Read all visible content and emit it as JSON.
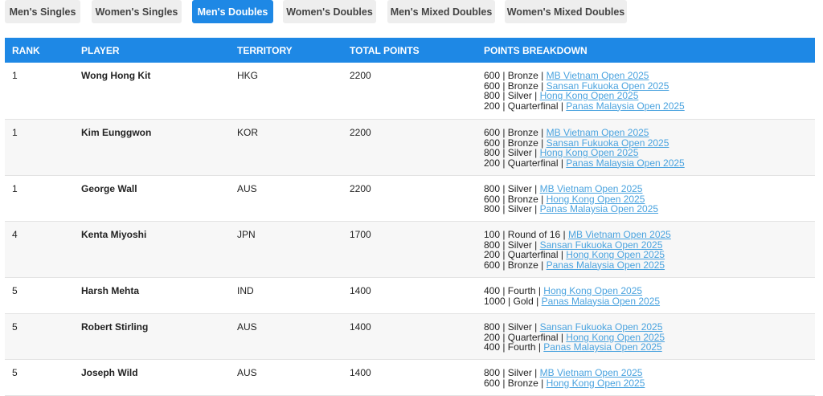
{
  "tabs": [
    {
      "label": "Men's Singles",
      "active": false
    },
    {
      "label": "Women's Singles",
      "active": false
    },
    {
      "label": "Men's Doubles",
      "active": true
    },
    {
      "label": "Women's Doubles",
      "active": false
    },
    {
      "label": "Men's Mixed Doubles",
      "active": false
    },
    {
      "label": "Women's Mixed Doubles",
      "active": false
    }
  ],
  "table": {
    "headers": {
      "rank": "RANK",
      "player": "PLAYER",
      "territory": "TERRITORY",
      "total": "TOTAL POINTS",
      "breakdown": "POINTS BREAKDOWN"
    },
    "rows": [
      {
        "rank": "1",
        "player": "Wong Hong Kit",
        "territory": "HKG",
        "total": "2200",
        "breakdown": [
          {
            "text": "600 | Bronze | ",
            "event": "MB Vietnam Open 2025"
          },
          {
            "text": "600 | Bronze | ",
            "event": "Sansan Fukuoka Open 2025"
          },
          {
            "text": "800 | Silver | ",
            "event": "Hong Kong Open 2025"
          },
          {
            "text": "200 | Quarterfinal | ",
            "event": "Panas Malaysia Open 2025"
          }
        ]
      },
      {
        "rank": "1",
        "player": "Kim Eunggwon",
        "territory": "KOR",
        "total": "2200",
        "breakdown": [
          {
            "text": "600 | Bronze | ",
            "event": "MB Vietnam Open 2025"
          },
          {
            "text": "600 | Bronze | ",
            "event": "Sansan Fukuoka Open 2025"
          },
          {
            "text": "800 | Silver | ",
            "event": "Hong Kong Open 2025"
          },
          {
            "text": "200 | Quarterfinal | ",
            "event": "Panas Malaysia Open 2025"
          }
        ]
      },
      {
        "rank": "1",
        "player": "George Wall",
        "territory": "AUS",
        "total": "2200",
        "breakdown": [
          {
            "text": "800 | Silver | ",
            "event": "MB Vietnam Open 2025"
          },
          {
            "text": "600 | Bronze | ",
            "event": "Hong Kong Open 2025"
          },
          {
            "text": "800 | Silver | ",
            "event": "Panas Malaysia Open 2025"
          }
        ]
      },
      {
        "rank": "4",
        "player": "Kenta Miyoshi",
        "territory": "JPN",
        "total": "1700",
        "breakdown": [
          {
            "text": "100 | Round of 16 | ",
            "event": "MB Vietnam Open 2025"
          },
          {
            "text": "800 | Silver | ",
            "event": "Sansan Fukuoka Open 2025"
          },
          {
            "text": "200 | Quarterfinal | ",
            "event": "Hong Kong Open 2025"
          },
          {
            "text": "600 | Bronze | ",
            "event": "Panas Malaysia Open 2025"
          }
        ]
      },
      {
        "rank": "5",
        "player": "Harsh Mehta",
        "territory": "IND",
        "total": "1400",
        "breakdown": [
          {
            "text": "400 | Fourth | ",
            "event": "Hong Kong Open 2025"
          },
          {
            "text": "1000 | Gold | ",
            "event": "Panas Malaysia Open 2025"
          }
        ]
      },
      {
        "rank": "5",
        "player": "Robert Stirling",
        "territory": "AUS",
        "total": "1400",
        "breakdown": [
          {
            "text": "800 | Silver | ",
            "event": "Sansan Fukuoka Open 2025"
          },
          {
            "text": "200 | Quarterfinal | ",
            "event": "Hong Kong Open 2025"
          },
          {
            "text": "400 | Fourth | ",
            "event": "Panas Malaysia Open 2025"
          }
        ]
      },
      {
        "rank": "5",
        "player": "Joseph Wild",
        "territory": "AUS",
        "total": "1400",
        "breakdown": [
          {
            "text": "800 | Silver | ",
            "event": "MB Vietnam Open 2025"
          },
          {
            "text": "600 | Bronze | ",
            "event": "Hong Kong Open 2025"
          }
        ]
      }
    ]
  },
  "colors": {
    "accent": "#1e88e5",
    "link": "#4aa3df",
    "tab_bg": "#eeeeee"
  }
}
